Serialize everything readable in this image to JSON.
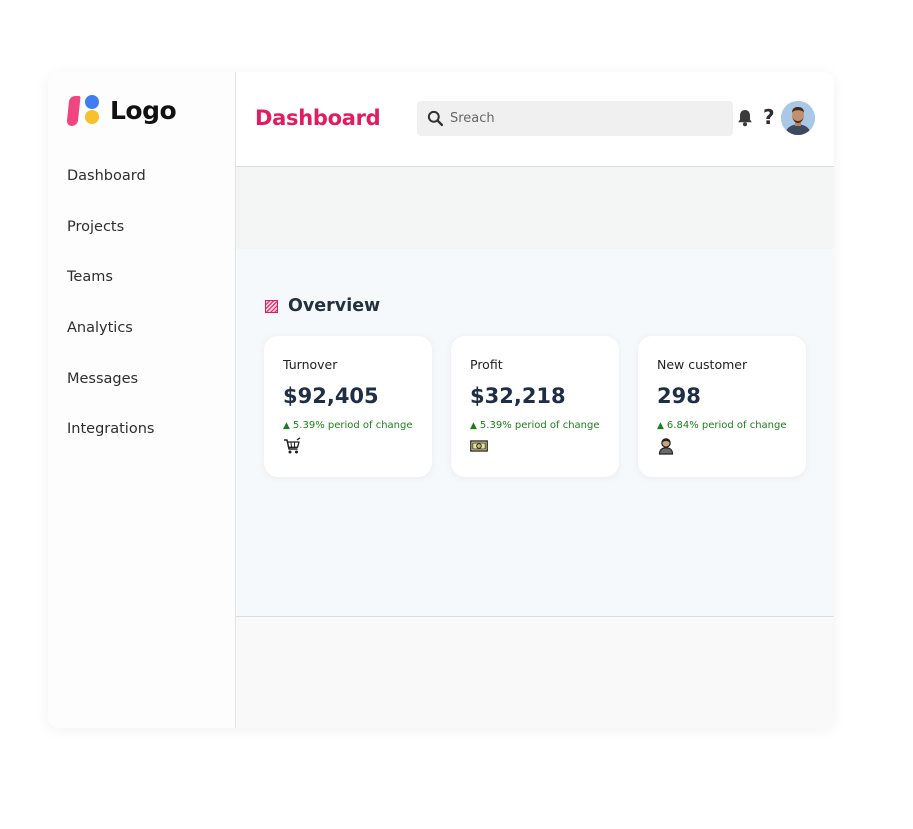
{
  "brand": {
    "logo_text": "Logo"
  },
  "sidebar": {
    "items": [
      {
        "label": "Dashboard"
      },
      {
        "label": "Projects"
      },
      {
        "label": "Teams"
      },
      {
        "label": "Analytics"
      },
      {
        "label": "Messages"
      },
      {
        "label": "Integrations"
      }
    ]
  },
  "header": {
    "title": "Dashboard",
    "search_placeholder": "Sreach",
    "help_label": "?",
    "icons": [
      "search-icon",
      "bell-icon",
      "help-icon",
      "avatar"
    ]
  },
  "overview": {
    "title": "Overview",
    "cards": [
      {
        "label": "Turnover",
        "value": "$92,405",
        "change": "5.39% period of change",
        "icon": "shopping-cart-icon"
      },
      {
        "label": "Profit",
        "value": "$32,218",
        "change": "5.39% period of change",
        "icon": "money-icon"
      },
      {
        "label": "New customer",
        "value": "298",
        "change": "6.84% period of change",
        "icon": "customer-icon"
      }
    ]
  },
  "colors": {
    "accent": "#e31c5f",
    "positive": "#1a7f1a",
    "logo_pink": "#f0457f",
    "logo_blue": "#3f7df5",
    "logo_yellow": "#f6c12b"
  }
}
